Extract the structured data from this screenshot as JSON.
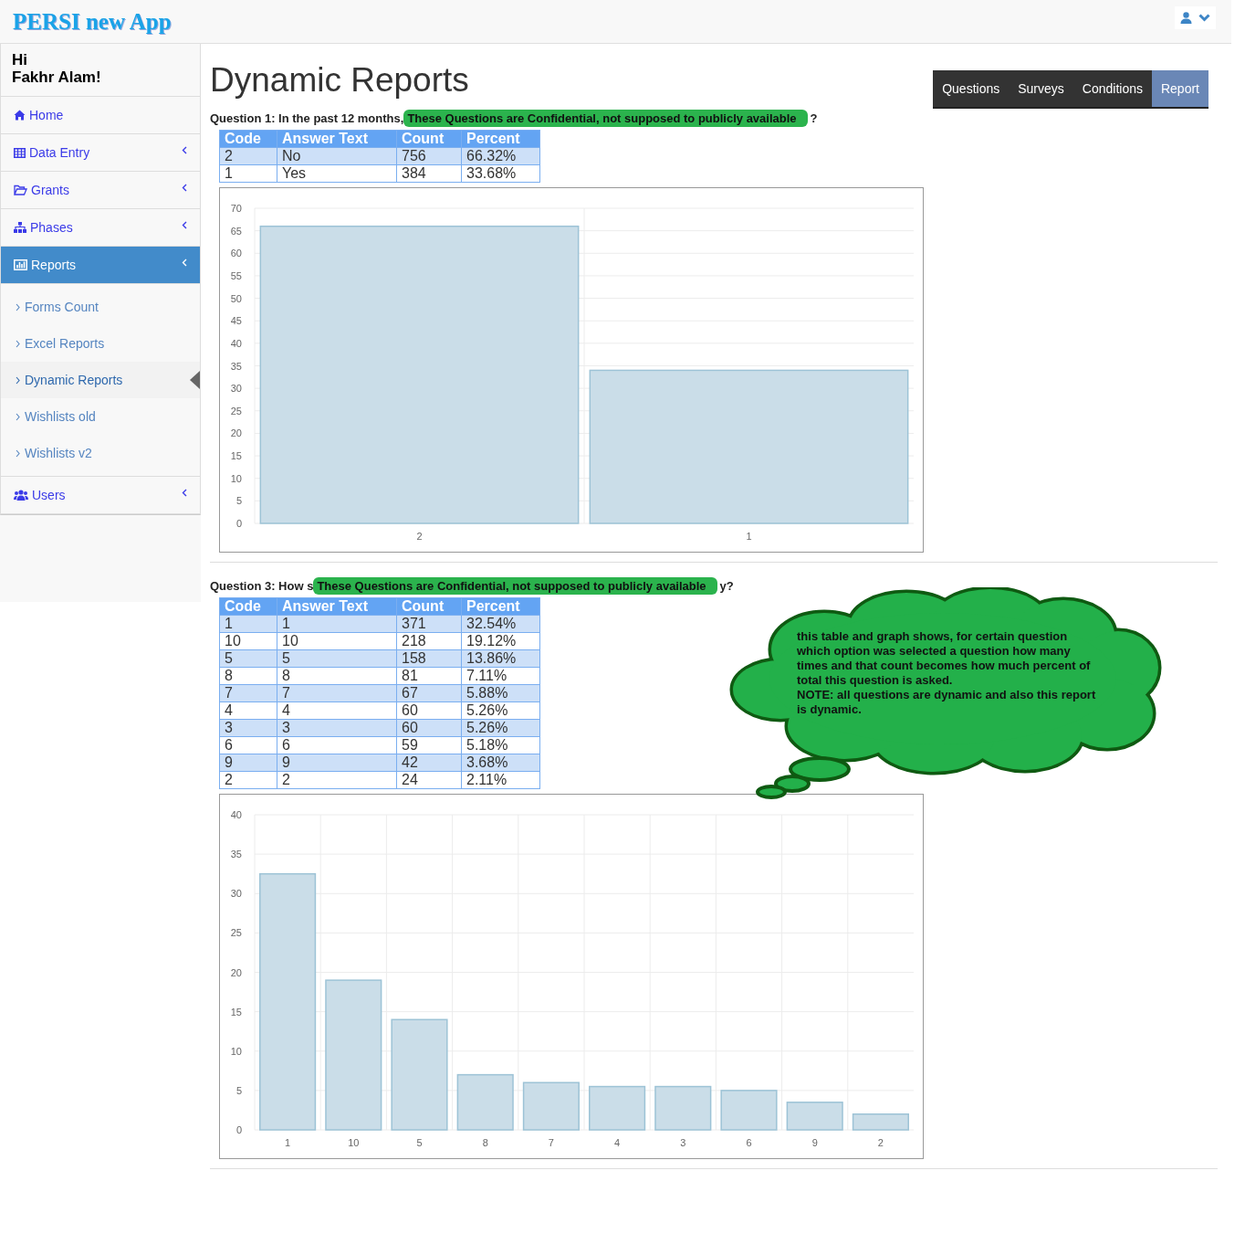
{
  "app": {
    "title": "PERSI new App"
  },
  "sidebar": {
    "greeting": "Hi",
    "user_name": "Fakhr Alam!",
    "items": [
      {
        "label": "Home",
        "selected": false,
        "has_submenu": false
      },
      {
        "label": "Data Entry",
        "selected": false,
        "has_submenu": true
      },
      {
        "label": "Grants",
        "selected": false,
        "has_submenu": true
      },
      {
        "label": "Phases",
        "selected": false,
        "has_submenu": true
      },
      {
        "label": "Reports",
        "selected": true,
        "has_submenu": true,
        "children": [
          {
            "label": "Forms Count",
            "selected": false
          },
          {
            "label": "Excel Reports",
            "selected": false
          },
          {
            "label": "Dynamic Reports",
            "selected": true
          },
          {
            "label": "Wishlists old",
            "selected": false
          },
          {
            "label": "Wishlists v2",
            "selected": false
          }
        ]
      },
      {
        "label": "Users",
        "selected": false,
        "has_submenu": true
      }
    ]
  },
  "page": {
    "title": "Dynamic Reports"
  },
  "tabs": [
    {
      "label": "Questions",
      "selected": false
    },
    {
      "label": "Surveys",
      "selected": false
    },
    {
      "label": "Conditions",
      "selected": false
    },
    {
      "label": "Report",
      "selected": true
    }
  ],
  "sections": [
    {
      "question": {
        "prefix": "Question 1: In the past 12 months,",
        "redacted": "These Questions are Confidential, not supposed to publicly available",
        "suffix": "?"
      },
      "table": {
        "columns": [
          "Code",
          "Answer Text",
          "Count",
          "Percent"
        ],
        "rows": [
          [
            "2",
            "No",
            "756",
            "66.32%"
          ],
          [
            "1",
            "Yes",
            "384",
            "33.68%"
          ]
        ]
      },
      "chart_data": {
        "type": "bar",
        "categories": [
          "2",
          "1"
        ],
        "values": [
          66,
          34
        ],
        "grid": true,
        "ylim": [
          0,
          70
        ],
        "yticks": [
          0,
          5,
          10,
          15,
          20,
          25,
          30,
          35,
          40,
          45,
          50,
          55,
          60,
          65,
          70
        ]
      }
    },
    {
      "question": {
        "prefix": "Question 3: How s",
        "redacted": "These Questions are Confidential, not supposed to publicly available",
        "suffix": "y?"
      },
      "table": {
        "columns": [
          "Code",
          "Answer Text",
          "Count",
          "Percent"
        ],
        "rows": [
          [
            "1",
            "1",
            "371",
            "32.54%"
          ],
          [
            "10",
            "10",
            "218",
            "19.12%"
          ],
          [
            "5",
            "5",
            "158",
            "13.86%"
          ],
          [
            "8",
            "8",
            "81",
            "7.11%"
          ],
          [
            "7",
            "7",
            "67",
            "5.88%"
          ],
          [
            "4",
            "4",
            "60",
            "5.26%"
          ],
          [
            "3",
            "3",
            "60",
            "5.26%"
          ],
          [
            "6",
            "6",
            "59",
            "5.18%"
          ],
          [
            "9",
            "9",
            "42",
            "3.68%"
          ],
          [
            "2",
            "2",
            "24",
            "2.11%"
          ]
        ]
      },
      "chart_data": {
        "type": "bar",
        "categories": [
          "1",
          "10",
          "5",
          "8",
          "7",
          "4",
          "3",
          "6",
          "9",
          "2"
        ],
        "values": [
          32.5,
          19,
          14,
          7,
          6,
          5.5,
          5.5,
          5,
          3.5,
          2
        ],
        "grid": true,
        "ylim": [
          0,
          40
        ],
        "yticks": [
          0,
          5,
          10,
          15,
          20,
          25,
          30,
          35,
          40
        ]
      },
      "callout": {
        "text": "this table and graph shows, for certain question which option was selected a question how many times and that count becomes how much percent of total this question is asked.",
        "note": "NOTE: all questions are dynamic and also this report is dynamic."
      }
    }
  ]
}
